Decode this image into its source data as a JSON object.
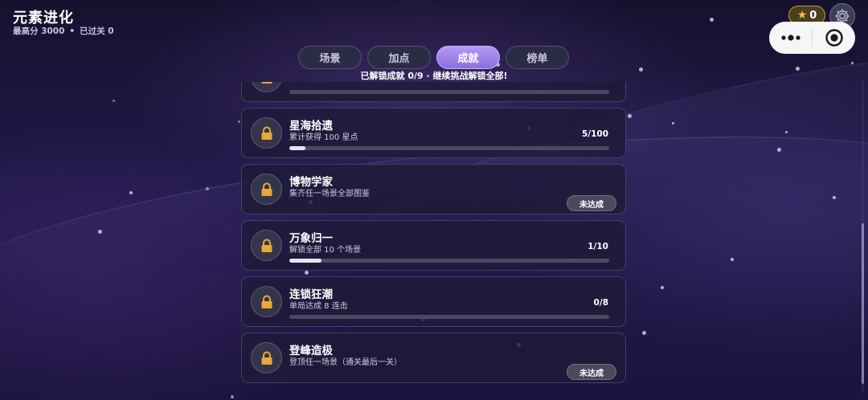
{
  "header": {
    "title": "元素进化",
    "best_score_label": "最高分 3000",
    "separator": "•",
    "levels_cleared_label": "已过关 0"
  },
  "currency": {
    "icon": "star-icon",
    "icon_glyph": "★",
    "value": "0",
    "color": "#f3c23b"
  },
  "settings": {
    "icon": "gear-icon"
  },
  "capsule": {
    "menu_icon": "more-dots-icon",
    "close_icon": "target-circle-icon"
  },
  "tabs": [
    {
      "label": "场景",
      "active": false
    },
    {
      "label": "加点",
      "active": false
    },
    {
      "label": "成就",
      "active": true
    },
    {
      "label": "榜单",
      "active": false
    }
  ],
  "summary_text": "已解锁成就 0/9 · 继续挑战解锁全部!",
  "achievements": [
    {
      "name": "",
      "desc": "",
      "count": "",
      "progress": 0.0,
      "status": "",
      "partial": true
    },
    {
      "name": "星海拾遗",
      "desc": "累计获得 100 星点",
      "count": "5/100",
      "progress": 0.05,
      "status": ""
    },
    {
      "name": "博物学家",
      "desc": "集齐任一场景全部图鉴",
      "count": "",
      "progress": null,
      "status": "未达成"
    },
    {
      "name": "万象归一",
      "desc": "解锁全部 10 个场景",
      "count": "1/10",
      "progress": 0.1,
      "status": ""
    },
    {
      "name": "连锁狂潮",
      "desc": "单局达成 8 连击",
      "count": "0/8",
      "progress": 0.0,
      "status": ""
    },
    {
      "name": "登峰造极",
      "desc": "登顶任一场景（通关最后一关）",
      "count": "",
      "progress": null,
      "status": "未达成"
    }
  ],
  "colors": {
    "accent": "#9b7fe8",
    "lock": "#e8a93a",
    "background": "#1c143f"
  }
}
